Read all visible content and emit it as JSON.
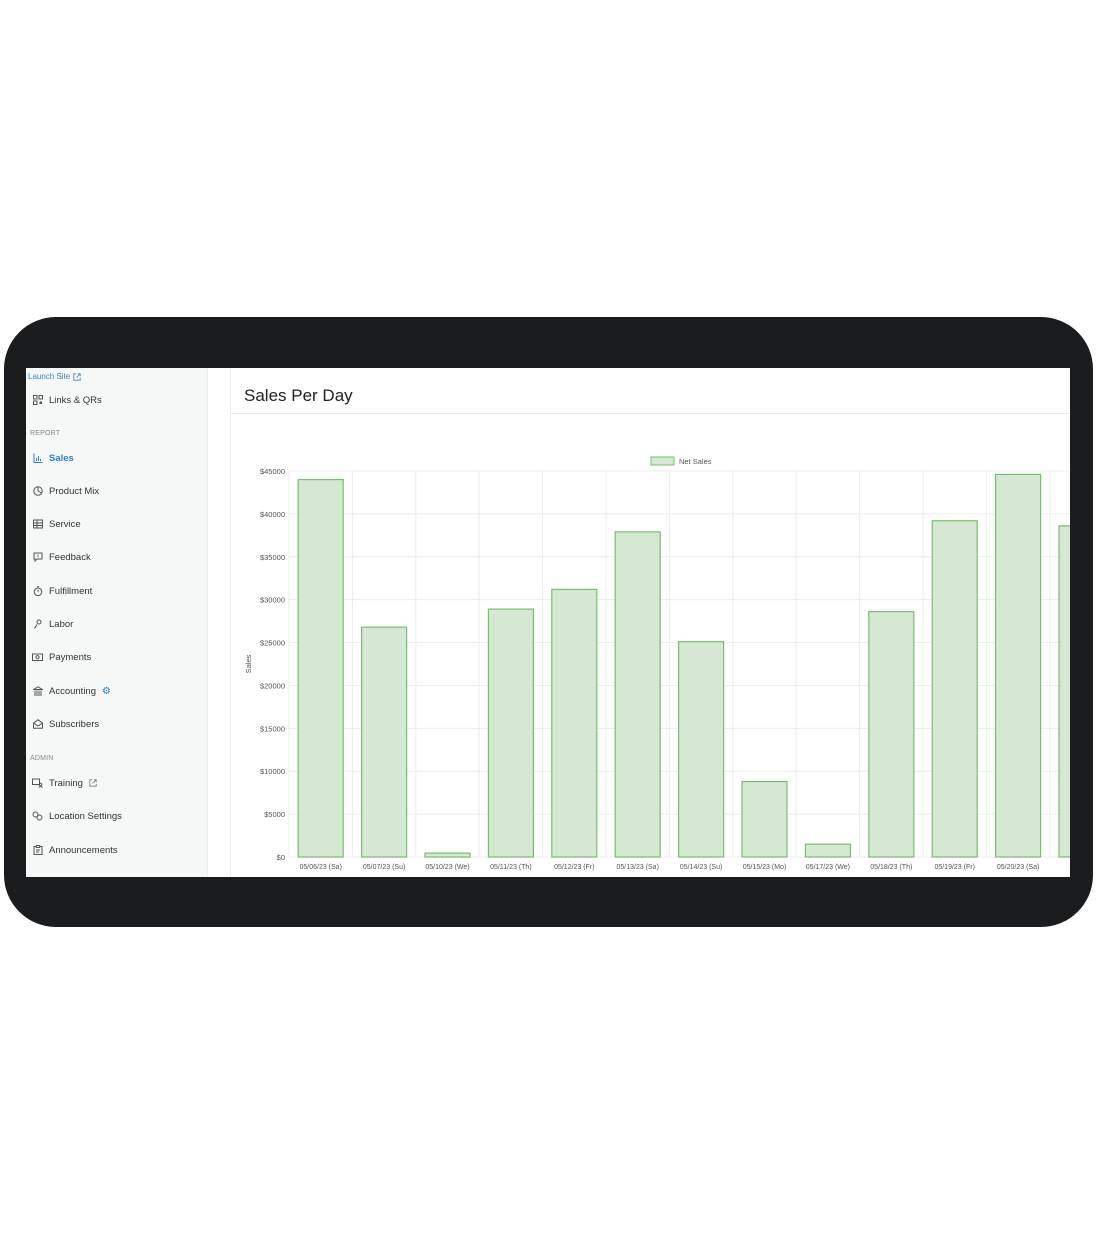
{
  "sidebar": {
    "launch_site": "Launch Site",
    "links_qrs": "Links & QRs",
    "section_report": "REPORT",
    "section_admin": "ADMIN",
    "items": [
      {
        "label": "Sales",
        "icon": "bar-chart-icon",
        "active": true
      },
      {
        "label": "Product Mix",
        "icon": "pie-chart-icon"
      },
      {
        "label": "Service",
        "icon": "table-icon"
      },
      {
        "label": "Feedback",
        "icon": "feedback-icon"
      },
      {
        "label": "Fulfillment",
        "icon": "stopwatch-icon"
      },
      {
        "label": "Labor",
        "icon": "person-icon"
      },
      {
        "label": "Payments",
        "icon": "cash-icon"
      },
      {
        "label": "Accounting",
        "icon": "bank-icon"
      },
      {
        "label": "Subscribers",
        "icon": "envelope-icon"
      }
    ],
    "admin_items": [
      {
        "label": "Training",
        "icon": "training-icon"
      },
      {
        "label": "Location Settings",
        "icon": "location-settings-icon"
      },
      {
        "label": "Announcements",
        "icon": "clipboard-icon"
      }
    ]
  },
  "main": {
    "title": "Sales Per Day"
  },
  "colors": {
    "accent": "#2b7fd4",
    "bar_fill": "#d5e8d2",
    "bar_stroke": "#7cbb76",
    "device": "#1b1c1d"
  },
  "chart_data": {
    "type": "bar",
    "categories": [
      "05/06/23 (Sa)",
      "05/07/23 (Su)",
      "05/10/23 (We)",
      "05/11/23 (Th)",
      "05/12/23 (Fr)",
      "05/13/23 (Sa)",
      "05/14/23 (Su)",
      "05/15/23 (Mo)",
      "05/17/23 (We)",
      "05/18/23 (Th)",
      "05/19/23 (Fr)",
      "05/20/23 (Sa)",
      "05/"
    ],
    "series": [
      {
        "name": "Net Sales",
        "values": [
          44000,
          26800,
          450,
          28900,
          31200,
          37900,
          25100,
          8800,
          1500,
          28600,
          39200,
          44600,
          38600
        ]
      }
    ],
    "ylabel": "Sales",
    "xlabel": "",
    "ylim": [
      0,
      45000
    ],
    "yticks": [
      "$0",
      "$5000",
      "$10000",
      "$15000",
      "$20000",
      "$25000",
      "$30000",
      "$35000",
      "$40000",
      "$45000"
    ],
    "grid": true,
    "legend": "top-center"
  }
}
